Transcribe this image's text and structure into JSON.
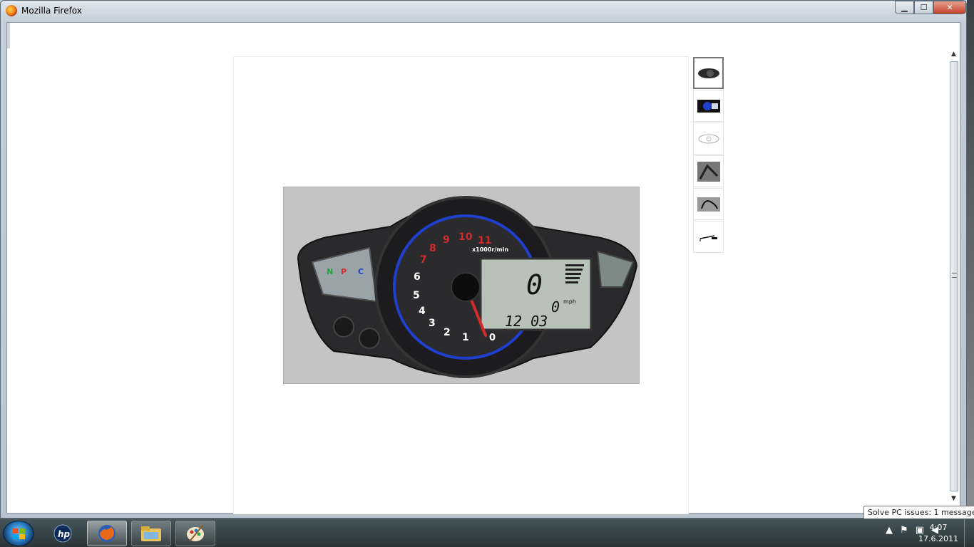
{
  "window": {
    "title": "Mozilla Firefox",
    "buttons": {
      "minimize": "▁",
      "maximize": "☐",
      "close": "✕"
    }
  },
  "product": {
    "gauge": {
      "rpm_labels": [
        "0",
        "1",
        "2",
        "3",
        "4",
        "5",
        "6",
        "7",
        "8",
        "9",
        "10",
        "11"
      ],
      "unit_label": "x1000r/min",
      "indicators": [
        "N",
        "P",
        "C"
      ],
      "lcd_speed": "0",
      "lcd_trip": "0",
      "lcd_trip_unit": "mph",
      "lcd_clock": "12 03"
    },
    "thumbnails": [
      "gauge-dark",
      "gauge-blue",
      "sketch",
      "mount",
      "bracket",
      "cable"
    ]
  },
  "taskbar": {
    "clock_time": "4:07",
    "clock_date": "17.6.2011",
    "tooltip": "Solve PC issues: 1 message",
    "apps": [
      "hp",
      "firefox",
      "explorer",
      "paint"
    ]
  },
  "colors": {
    "accent_red": "#d32a2a",
    "lcd_bg": "#b8c2b8",
    "gauge_blue": "#1f3fcc"
  }
}
